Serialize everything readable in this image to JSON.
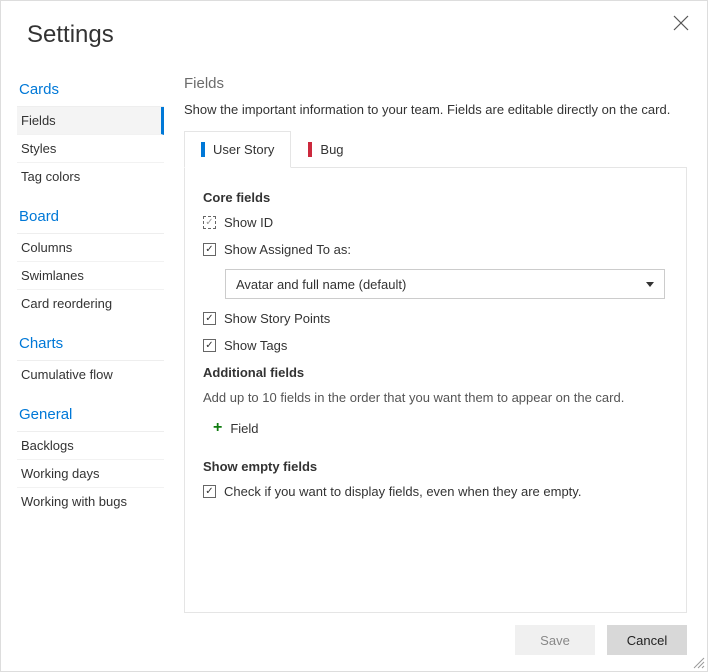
{
  "dialog": {
    "title": "Settings"
  },
  "sidebar": {
    "groups": [
      {
        "heading": "Cards",
        "items": [
          "Fields",
          "Styles",
          "Tag colors"
        ],
        "selected": 0
      },
      {
        "heading": "Board",
        "items": [
          "Columns",
          "Swimlanes",
          "Card reordering"
        ]
      },
      {
        "heading": "Charts",
        "items": [
          "Cumulative flow"
        ]
      },
      {
        "heading": "General",
        "items": [
          "Backlogs",
          "Working days",
          "Working with bugs"
        ]
      }
    ]
  },
  "main": {
    "title": "Fields",
    "description": "Show the important information to your team. Fields are editable directly on the card.",
    "tabs": [
      {
        "label": "User Story",
        "color": "#0078D7",
        "active": true
      },
      {
        "label": "Bug",
        "color": "#CC293D",
        "active": false
      }
    ],
    "core": {
      "heading": "Core fields",
      "showId": {
        "label": "Show ID",
        "checked": true,
        "disabled": true
      },
      "showAssigned": {
        "label": "Show Assigned To as:",
        "checked": true
      },
      "assignedDropdown": "Avatar and full name (default)",
      "showStoryPoints": {
        "label": "Show Story Points",
        "checked": true
      },
      "showTags": {
        "label": "Show Tags",
        "checked": true
      }
    },
    "additional": {
      "heading": "Additional fields",
      "description": "Add up to 10 fields in the order that you want them to appear on the card.",
      "addLabel": "Field"
    },
    "empty": {
      "heading": "Show empty fields",
      "checkbox": {
        "label": "Check if you want to display fields, even when they are empty.",
        "checked": true
      }
    }
  },
  "footer": {
    "save": "Save",
    "cancel": "Cancel"
  }
}
